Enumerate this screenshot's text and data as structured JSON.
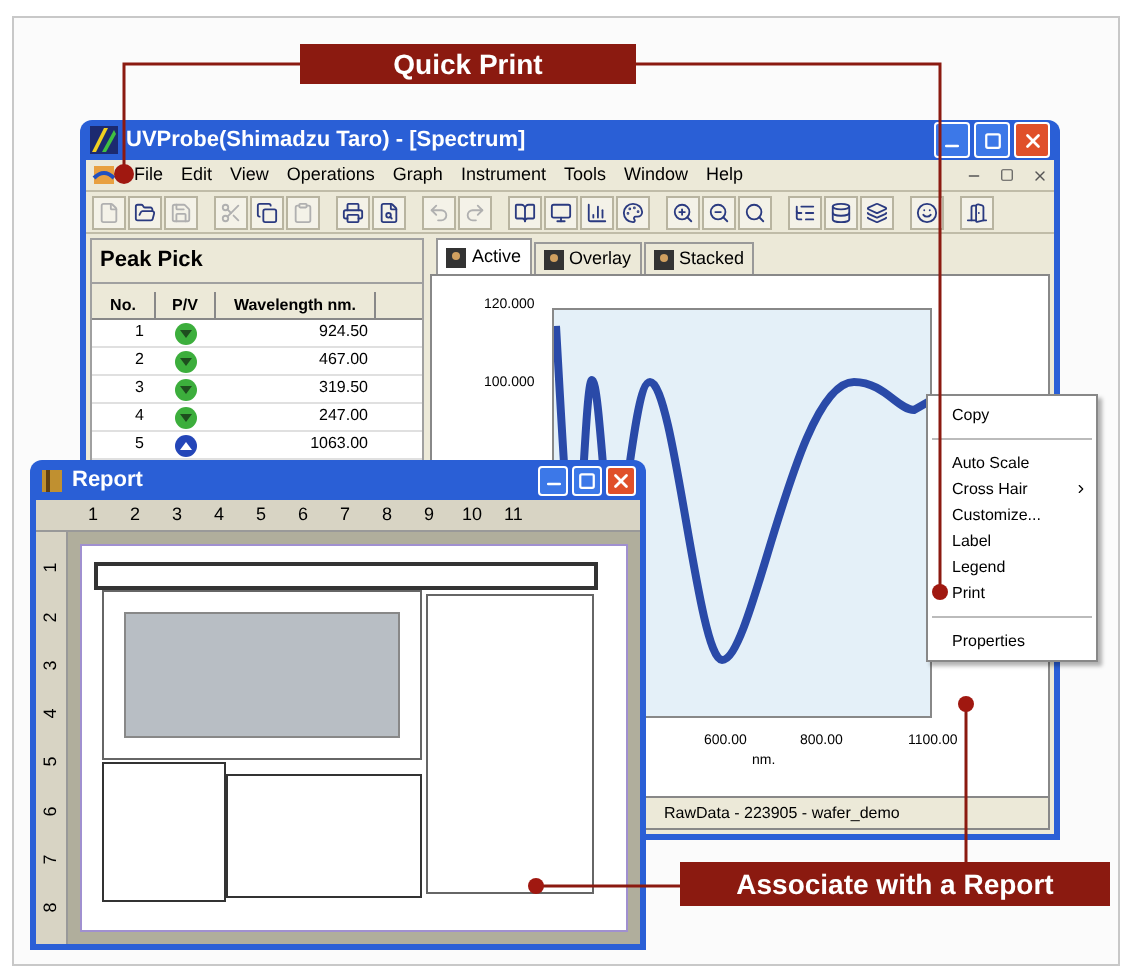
{
  "callouts": [
    {
      "kind": "top",
      "label": "Quick Print"
    },
    {
      "kind": "bottom",
      "label": "Associate with a Report"
    }
  ],
  "main_window": {
    "title": "UVProbe(Shimadzu Taro) - [Spectrum]",
    "menu": [
      "File",
      "Edit",
      "View",
      "Operations",
      "Graph",
      "Instrument",
      "Tools",
      "Window",
      "Help"
    ],
    "peak_pick": {
      "title": "Peak Pick",
      "columns": [
        "No.",
        "P/V",
        "Wavelength nm."
      ],
      "rows": [
        {
          "no": "1",
          "kind": "valley",
          "wavelength": "924.50"
        },
        {
          "no": "2",
          "kind": "valley",
          "wavelength": "467.00"
        },
        {
          "no": "3",
          "kind": "valley",
          "wavelength": "319.50"
        },
        {
          "no": "4",
          "kind": "valley",
          "wavelength": "247.00"
        },
        {
          "no": "5",
          "kind": "peak",
          "wavelength": "1063.00"
        }
      ]
    },
    "tabs": [
      {
        "label": "Active",
        "selected": true
      },
      {
        "label": "Overlay",
        "selected": false
      },
      {
        "label": "Stacked",
        "selected": false
      }
    ],
    "graph": {
      "yticks": [
        "120.000",
        "100.000"
      ],
      "xticks": [
        "600.00",
        "800.00",
        "1100.00"
      ],
      "xlabel": "nm."
    },
    "context_menu": [
      {
        "kind": "item",
        "label": "Copy",
        "submenu": false
      },
      {
        "kind": "separator"
      },
      {
        "kind": "item",
        "label": "Auto Scale",
        "submenu": false
      },
      {
        "kind": "item",
        "label": "Cross Hair",
        "submenu": true
      },
      {
        "kind": "item",
        "label": "Customize...",
        "submenu": false
      },
      {
        "kind": "item",
        "label": "Label",
        "submenu": false
      },
      {
        "kind": "item",
        "label": "Legend",
        "submenu": false
      },
      {
        "kind": "item",
        "label": "Print",
        "submenu": false
      },
      {
        "kind": "separator"
      },
      {
        "kind": "item",
        "label": "Properties",
        "submenu": false
      }
    ],
    "status_bar": "RawData - 223905 - wafer_demo"
  },
  "report_window": {
    "title": "Report",
    "ruler_h": [
      "1",
      "2",
      "3",
      "4",
      "5",
      "6",
      "7",
      "8",
      "9",
      "10",
      "11"
    ],
    "ruler_v": [
      "1",
      "2",
      "3",
      "4",
      "5",
      "6",
      "7",
      "8"
    ]
  }
}
